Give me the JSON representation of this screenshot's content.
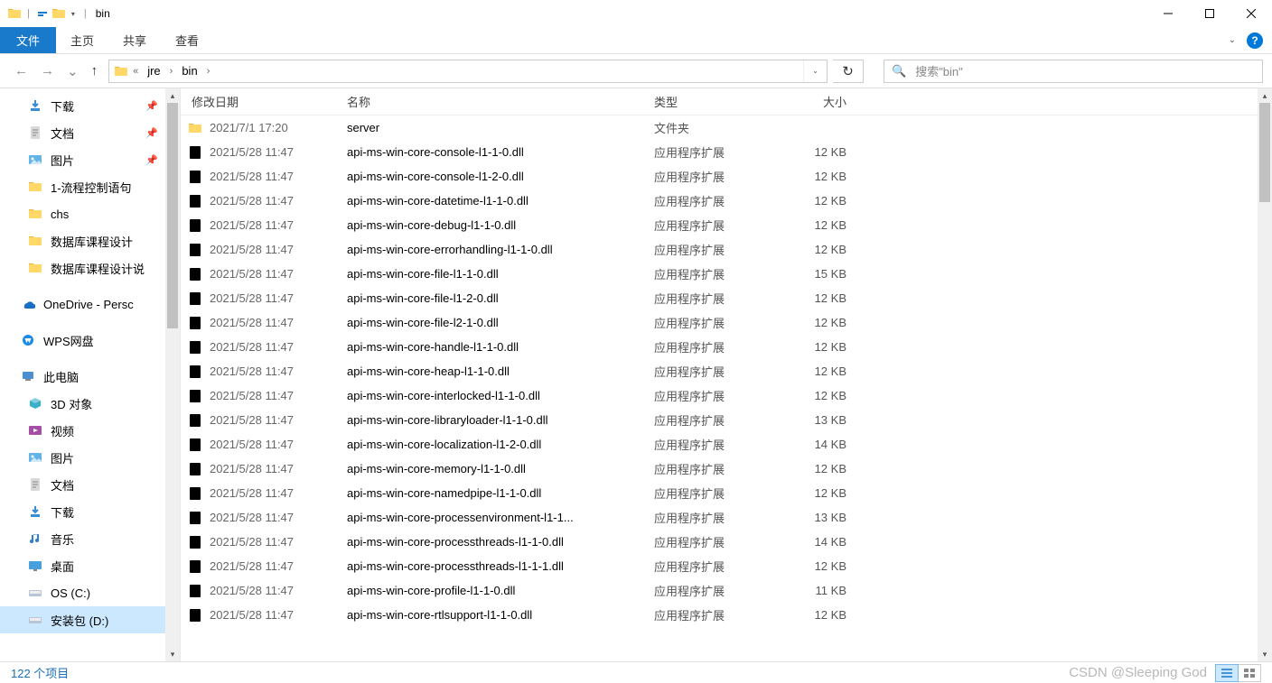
{
  "titlebar": {
    "title": "bin"
  },
  "ribbon": {
    "file": "文件",
    "tabs": [
      "主页",
      "共享",
      "查看"
    ]
  },
  "breadcrumb": {
    "segments": [
      "jre",
      "bin"
    ],
    "prefix_chev": "«"
  },
  "search": {
    "placeholder": "搜索\"bin\""
  },
  "sidebar": {
    "items": [
      {
        "label": "下载",
        "icon": "download",
        "pinned": true
      },
      {
        "label": "文档",
        "icon": "document",
        "pinned": true
      },
      {
        "label": "图片",
        "icon": "picture",
        "pinned": true
      },
      {
        "label": "1-流程控制语句",
        "icon": "folder"
      },
      {
        "label": "chs",
        "icon": "folder"
      },
      {
        "label": "数据库课程设计",
        "icon": "folder"
      },
      {
        "label": "数据库课程设计说",
        "icon": "folder"
      }
    ],
    "clouds": [
      {
        "label": "OneDrive - Persc",
        "icon": "onedrive"
      },
      {
        "label": "WPS网盘",
        "icon": "wps"
      }
    ],
    "thispc": {
      "label": "此电脑",
      "icon": "pc"
    },
    "pc_items": [
      {
        "label": "3D 对象",
        "icon": "3d"
      },
      {
        "label": "视频",
        "icon": "video"
      },
      {
        "label": "图片",
        "icon": "picture"
      },
      {
        "label": "文档",
        "icon": "document"
      },
      {
        "label": "下载",
        "icon": "download"
      },
      {
        "label": "音乐",
        "icon": "music"
      },
      {
        "label": "桌面",
        "icon": "desktop"
      },
      {
        "label": "OS (C:)",
        "icon": "disk"
      },
      {
        "label": "安装包 (D:)",
        "icon": "disk",
        "selected": true
      }
    ]
  },
  "columns": {
    "date": "修改日期",
    "name": "名称",
    "type": "类型",
    "size": "大小"
  },
  "types": {
    "folder": "文件夹",
    "dll": "应用程序扩展"
  },
  "files": [
    {
      "date": "2021/7/1 17:20",
      "name": "server",
      "type": "folder",
      "size": ""
    },
    {
      "date": "2021/5/28 11:47",
      "name": "api-ms-win-core-console-l1-1-0.dll",
      "type": "dll",
      "size": "12 KB"
    },
    {
      "date": "2021/5/28 11:47",
      "name": "api-ms-win-core-console-l1-2-0.dll",
      "type": "dll",
      "size": "12 KB"
    },
    {
      "date": "2021/5/28 11:47",
      "name": "api-ms-win-core-datetime-l1-1-0.dll",
      "type": "dll",
      "size": "12 KB"
    },
    {
      "date": "2021/5/28 11:47",
      "name": "api-ms-win-core-debug-l1-1-0.dll",
      "type": "dll",
      "size": "12 KB"
    },
    {
      "date": "2021/5/28 11:47",
      "name": "api-ms-win-core-errorhandling-l1-1-0.dll",
      "type": "dll",
      "size": "12 KB"
    },
    {
      "date": "2021/5/28 11:47",
      "name": "api-ms-win-core-file-l1-1-0.dll",
      "type": "dll",
      "size": "15 KB"
    },
    {
      "date": "2021/5/28 11:47",
      "name": "api-ms-win-core-file-l1-2-0.dll",
      "type": "dll",
      "size": "12 KB"
    },
    {
      "date": "2021/5/28 11:47",
      "name": "api-ms-win-core-file-l2-1-0.dll",
      "type": "dll",
      "size": "12 KB"
    },
    {
      "date": "2021/5/28 11:47",
      "name": "api-ms-win-core-handle-l1-1-0.dll",
      "type": "dll",
      "size": "12 KB"
    },
    {
      "date": "2021/5/28 11:47",
      "name": "api-ms-win-core-heap-l1-1-0.dll",
      "type": "dll",
      "size": "12 KB"
    },
    {
      "date": "2021/5/28 11:47",
      "name": "api-ms-win-core-interlocked-l1-1-0.dll",
      "type": "dll",
      "size": "12 KB"
    },
    {
      "date": "2021/5/28 11:47",
      "name": "api-ms-win-core-libraryloader-l1-1-0.dll",
      "type": "dll",
      "size": "13 KB"
    },
    {
      "date": "2021/5/28 11:47",
      "name": "api-ms-win-core-localization-l1-2-0.dll",
      "type": "dll",
      "size": "14 KB"
    },
    {
      "date": "2021/5/28 11:47",
      "name": "api-ms-win-core-memory-l1-1-0.dll",
      "type": "dll",
      "size": "12 KB"
    },
    {
      "date": "2021/5/28 11:47",
      "name": "api-ms-win-core-namedpipe-l1-1-0.dll",
      "type": "dll",
      "size": "12 KB"
    },
    {
      "date": "2021/5/28 11:47",
      "name": "api-ms-win-core-processenvironment-l1-1...",
      "type": "dll",
      "size": "13 KB"
    },
    {
      "date": "2021/5/28 11:47",
      "name": "api-ms-win-core-processthreads-l1-1-0.dll",
      "type": "dll",
      "size": "14 KB"
    },
    {
      "date": "2021/5/28 11:47",
      "name": "api-ms-win-core-processthreads-l1-1-1.dll",
      "type": "dll",
      "size": "12 KB"
    },
    {
      "date": "2021/5/28 11:47",
      "name": "api-ms-win-core-profile-l1-1-0.dll",
      "type": "dll",
      "size": "11 KB"
    },
    {
      "date": "2021/5/28 11:47",
      "name": "api-ms-win-core-rtlsupport-l1-1-0.dll",
      "type": "dll",
      "size": "12 KB"
    }
  ],
  "status": {
    "count": "122 个项目"
  },
  "watermark": "CSDN @Sleeping God"
}
